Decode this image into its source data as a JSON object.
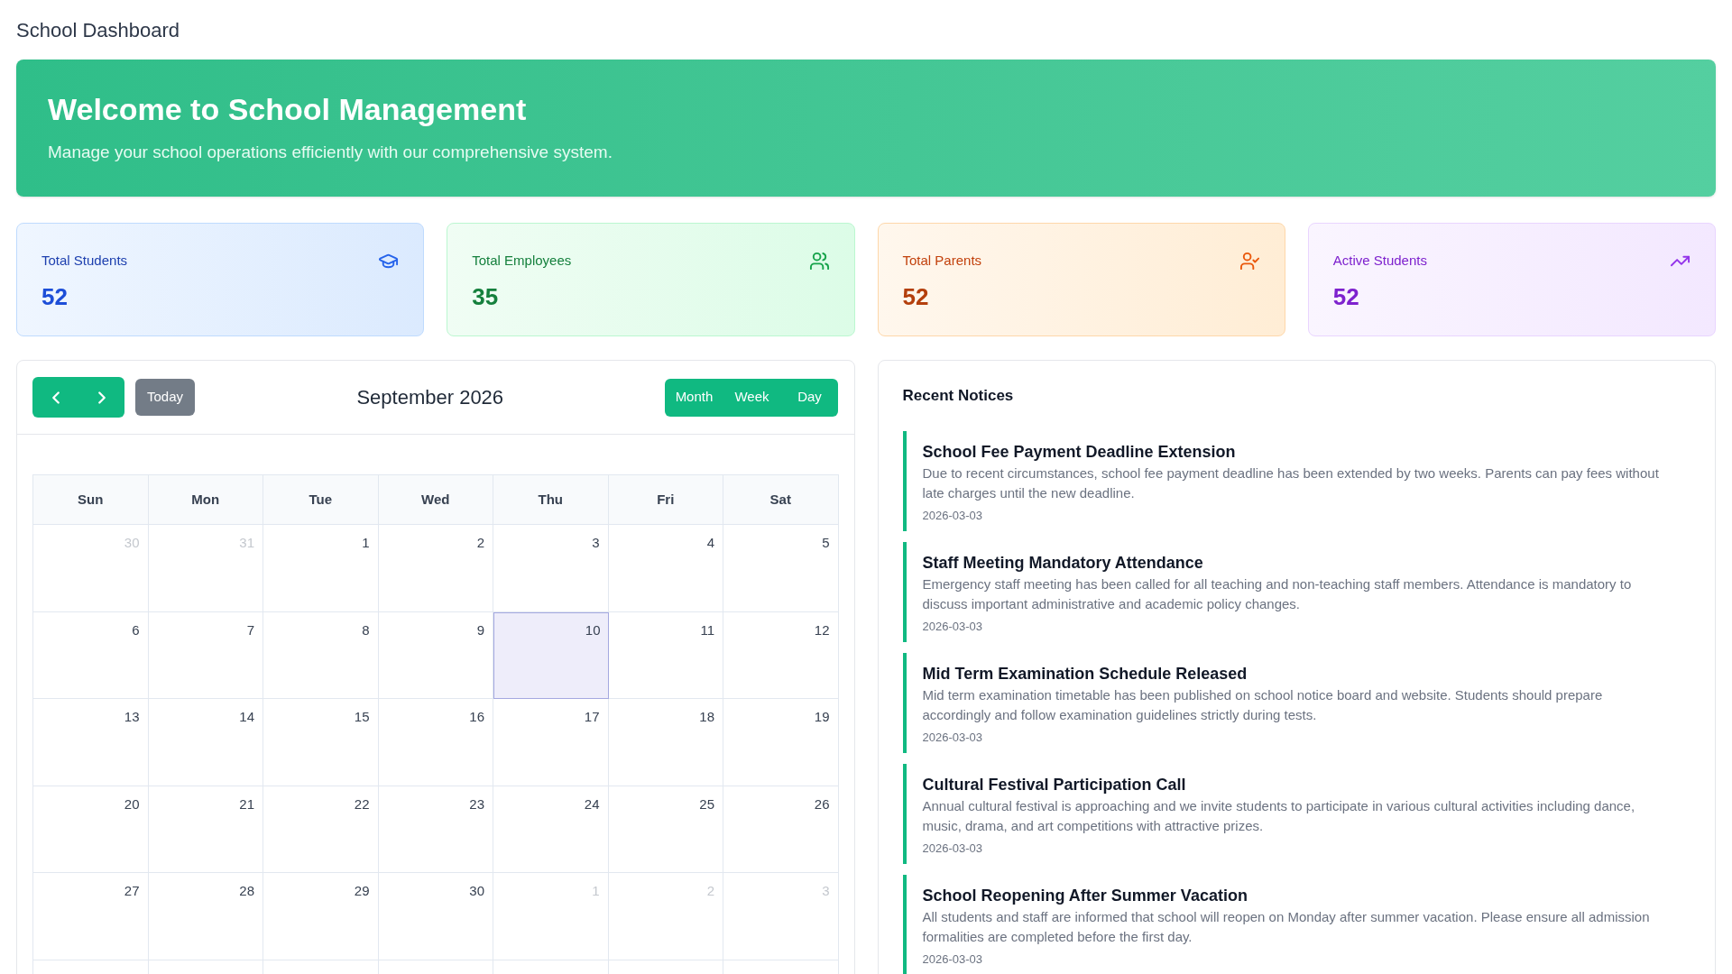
{
  "page_title": "School Dashboard",
  "banner": {
    "title": "Welcome to School Management",
    "subtitle": "Manage your school operations efficiently with our comprehensive system."
  },
  "stats": [
    {
      "kind": "students",
      "label": "Total Students",
      "value": "52"
    },
    {
      "kind": "employees",
      "label": "Total Employees",
      "value": "35"
    },
    {
      "kind": "parents",
      "label": "Total Parents",
      "value": "52"
    },
    {
      "kind": "active",
      "label": "Active Students",
      "value": "52"
    }
  ],
  "calendar": {
    "today_button": {
      "label": "Today",
      "disabled": true
    },
    "title": "September 2026",
    "views": [
      "Month",
      "Week",
      "Day"
    ],
    "weekdays": [
      "Sun",
      "Mon",
      "Tue",
      "Wed",
      "Thu",
      "Fri",
      "Sat"
    ],
    "weeks": [
      [
        {
          "day": "30",
          "outside": true,
          "today": false
        },
        {
          "day": "31",
          "outside": true,
          "today": false
        },
        {
          "day": "1",
          "outside": false,
          "today": false
        },
        {
          "day": "2",
          "outside": false,
          "today": false
        },
        {
          "day": "3",
          "outside": false,
          "today": false
        },
        {
          "day": "4",
          "outside": false,
          "today": false
        },
        {
          "day": "5",
          "outside": false,
          "today": false
        }
      ],
      [
        {
          "day": "6",
          "outside": false,
          "today": false
        },
        {
          "day": "7",
          "outside": false,
          "today": false
        },
        {
          "day": "8",
          "outside": false,
          "today": false
        },
        {
          "day": "9",
          "outside": false,
          "today": false
        },
        {
          "day": "10",
          "outside": false,
          "today": true
        },
        {
          "day": "11",
          "outside": false,
          "today": false
        },
        {
          "day": "12",
          "outside": false,
          "today": false
        }
      ],
      [
        {
          "day": "13",
          "outside": false,
          "today": false
        },
        {
          "day": "14",
          "outside": false,
          "today": false
        },
        {
          "day": "15",
          "outside": false,
          "today": false
        },
        {
          "day": "16",
          "outside": false,
          "today": false
        },
        {
          "day": "17",
          "outside": false,
          "today": false
        },
        {
          "day": "18",
          "outside": false,
          "today": false
        },
        {
          "day": "19",
          "outside": false,
          "today": false
        }
      ],
      [
        {
          "day": "20",
          "outside": false,
          "today": false
        },
        {
          "day": "21",
          "outside": false,
          "today": false
        },
        {
          "day": "22",
          "outside": false,
          "today": false
        },
        {
          "day": "23",
          "outside": false,
          "today": false
        },
        {
          "day": "24",
          "outside": false,
          "today": false
        },
        {
          "day": "25",
          "outside": false,
          "today": false
        },
        {
          "day": "26",
          "outside": false,
          "today": false
        }
      ],
      [
        {
          "day": "27",
          "outside": false,
          "today": false
        },
        {
          "day": "28",
          "outside": false,
          "today": false
        },
        {
          "day": "29",
          "outside": false,
          "today": false
        },
        {
          "day": "30",
          "outside": false,
          "today": false
        },
        {
          "day": "1",
          "outside": true,
          "today": false
        },
        {
          "day": "2",
          "outside": true,
          "today": false
        },
        {
          "day": "3",
          "outside": true,
          "today": false
        }
      ]
    ]
  },
  "notices": {
    "title": "Recent Notices",
    "items": [
      {
        "title": "School Fee Payment Deadline Extension",
        "body": "Due to recent circumstances, school fee payment deadline has been extended by two weeks. Parents can pay fees without late charges until the new deadline.",
        "date": "2026-03-03"
      },
      {
        "title": "Staff Meeting Mandatory Attendance",
        "body": "Emergency staff meeting has been called for all teaching and non-teaching staff members. Attendance is mandatory to discuss important administrative and academic policy changes.",
        "date": "2026-03-03"
      },
      {
        "title": "Mid Term Examination Schedule Released",
        "body": "Mid term examination timetable has been published on school notice board and website. Students should prepare accordingly and follow examination guidelines strictly during tests.",
        "date": "2026-03-03"
      },
      {
        "title": "Cultural Festival Participation Call",
        "body": "Annual cultural festival is approaching and we invite students to participate in various cultural activities including dance, music, drama, and art competitions with attractive prizes.",
        "date": "2026-03-03"
      },
      {
        "title": "School Reopening After Summer Vacation",
        "body": "All students and staff are informed that school will reopen on Monday after summer vacation. Please ensure all admission formalities are completed before the first day.",
        "date": "2026-03-03"
      }
    ]
  }
}
